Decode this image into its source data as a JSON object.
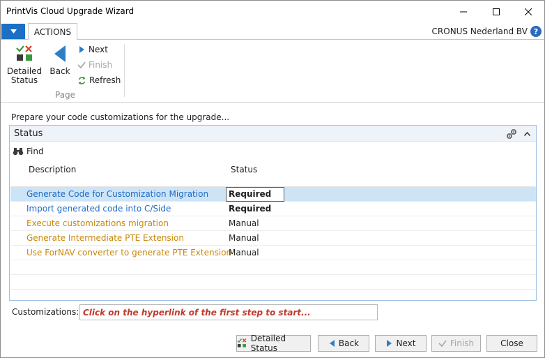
{
  "window": {
    "title": "PrintVis Cloud Upgrade Wizard"
  },
  "ribbon": {
    "tab": "ACTIONS",
    "company": "CRONUS Nederland BV",
    "detailed_status": "Detailed Status",
    "back": "Back",
    "next": "Next",
    "finish": "Finish",
    "refresh": "Refresh",
    "group_label": "Page"
  },
  "instruction": "Prepare your code customizations for the upgrade...",
  "status_panel": {
    "title": "Status",
    "find": "Find",
    "columns": {
      "description": "Description",
      "status": "Status"
    },
    "rows": [
      {
        "description": "Generate Code for Customization Migration",
        "status": "Required"
      },
      {
        "description": "Import generated code into C/Side",
        "status": "Required"
      },
      {
        "description": "Execute customizations migration",
        "status": "Manual"
      },
      {
        "description": "Generate Intermediate PTE Extension",
        "status": "Manual"
      },
      {
        "description": "Use ForNAV converter to generate PTE Extension",
        "status": "Manual"
      }
    ]
  },
  "customizations": {
    "label": "Customizations:",
    "value": "Click on the hyperlink of the first step to start..."
  },
  "footer": {
    "detailed_status": "Detailed Status",
    "back": "Back",
    "next": "Next",
    "finish": "Finish",
    "close": "Close"
  },
  "colors": {
    "accent": "#1b6fc4",
    "link": "#1f6bc4",
    "manual": "#c8880a",
    "hint": "#c0392b",
    "selection": "#cde4f7"
  }
}
